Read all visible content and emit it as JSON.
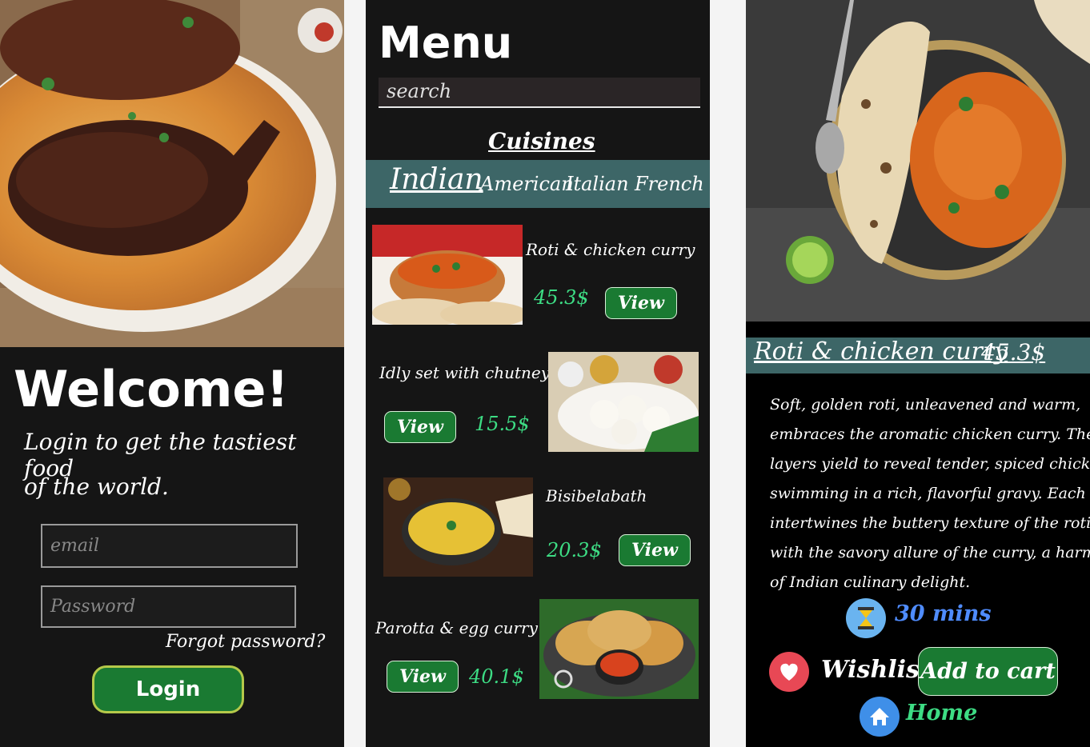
{
  "login": {
    "title": "Welcome!",
    "subtitle_line1": "Login to get the tastiest food",
    "subtitle_line2": "of the world.",
    "email_placeholder": "email",
    "password_placeholder": "Password",
    "forgot": "Forgot password?",
    "login_label": "Login"
  },
  "menu": {
    "title": "Menu",
    "search_placeholder": "search",
    "cuisines_heading": "Cuisines",
    "cuisines": [
      "Indian",
      "American",
      "Italian",
      "French"
    ],
    "selected_cuisine": "Indian",
    "items": [
      {
        "name": "Roti  & chicken curry",
        "price": "45.3$",
        "button": "View"
      },
      {
        "name": "Idly set with chutney",
        "price": "15.5$",
        "button": "View"
      },
      {
        "name": "Bisibelabath",
        "price": "20.3$",
        "button": "View"
      },
      {
        "name": "Parotta  & egg curry",
        "price": "40.1$",
        "button": "View"
      }
    ]
  },
  "detail": {
    "name": "Roti & chicken curry",
    "price": "45.3$",
    "description": [
      "Soft, golden roti, unleavened and warm,",
      "embraces the aromatic chicken curry. The flaky",
      "layers yield to reveal tender, spiced chicken,",
      "swimming in a rich, flavorful gravy. Each bite",
      "intertwines the buttery texture of the roti",
      "with the savory allure of the curry, a harmony",
      "of Indian culinary delight."
    ],
    "time": "30 mins",
    "wishlist": "Wishlist",
    "add_to_cart": "Add to cart",
    "home": "Home"
  },
  "colors": {
    "panel_bg": "#151515",
    "accent_green": "#1a7a32",
    "price_green": "#3ddc84",
    "teal_bar": "#3d6667",
    "time_blue": "#4f8cff",
    "home_green": "#3ddc84"
  }
}
